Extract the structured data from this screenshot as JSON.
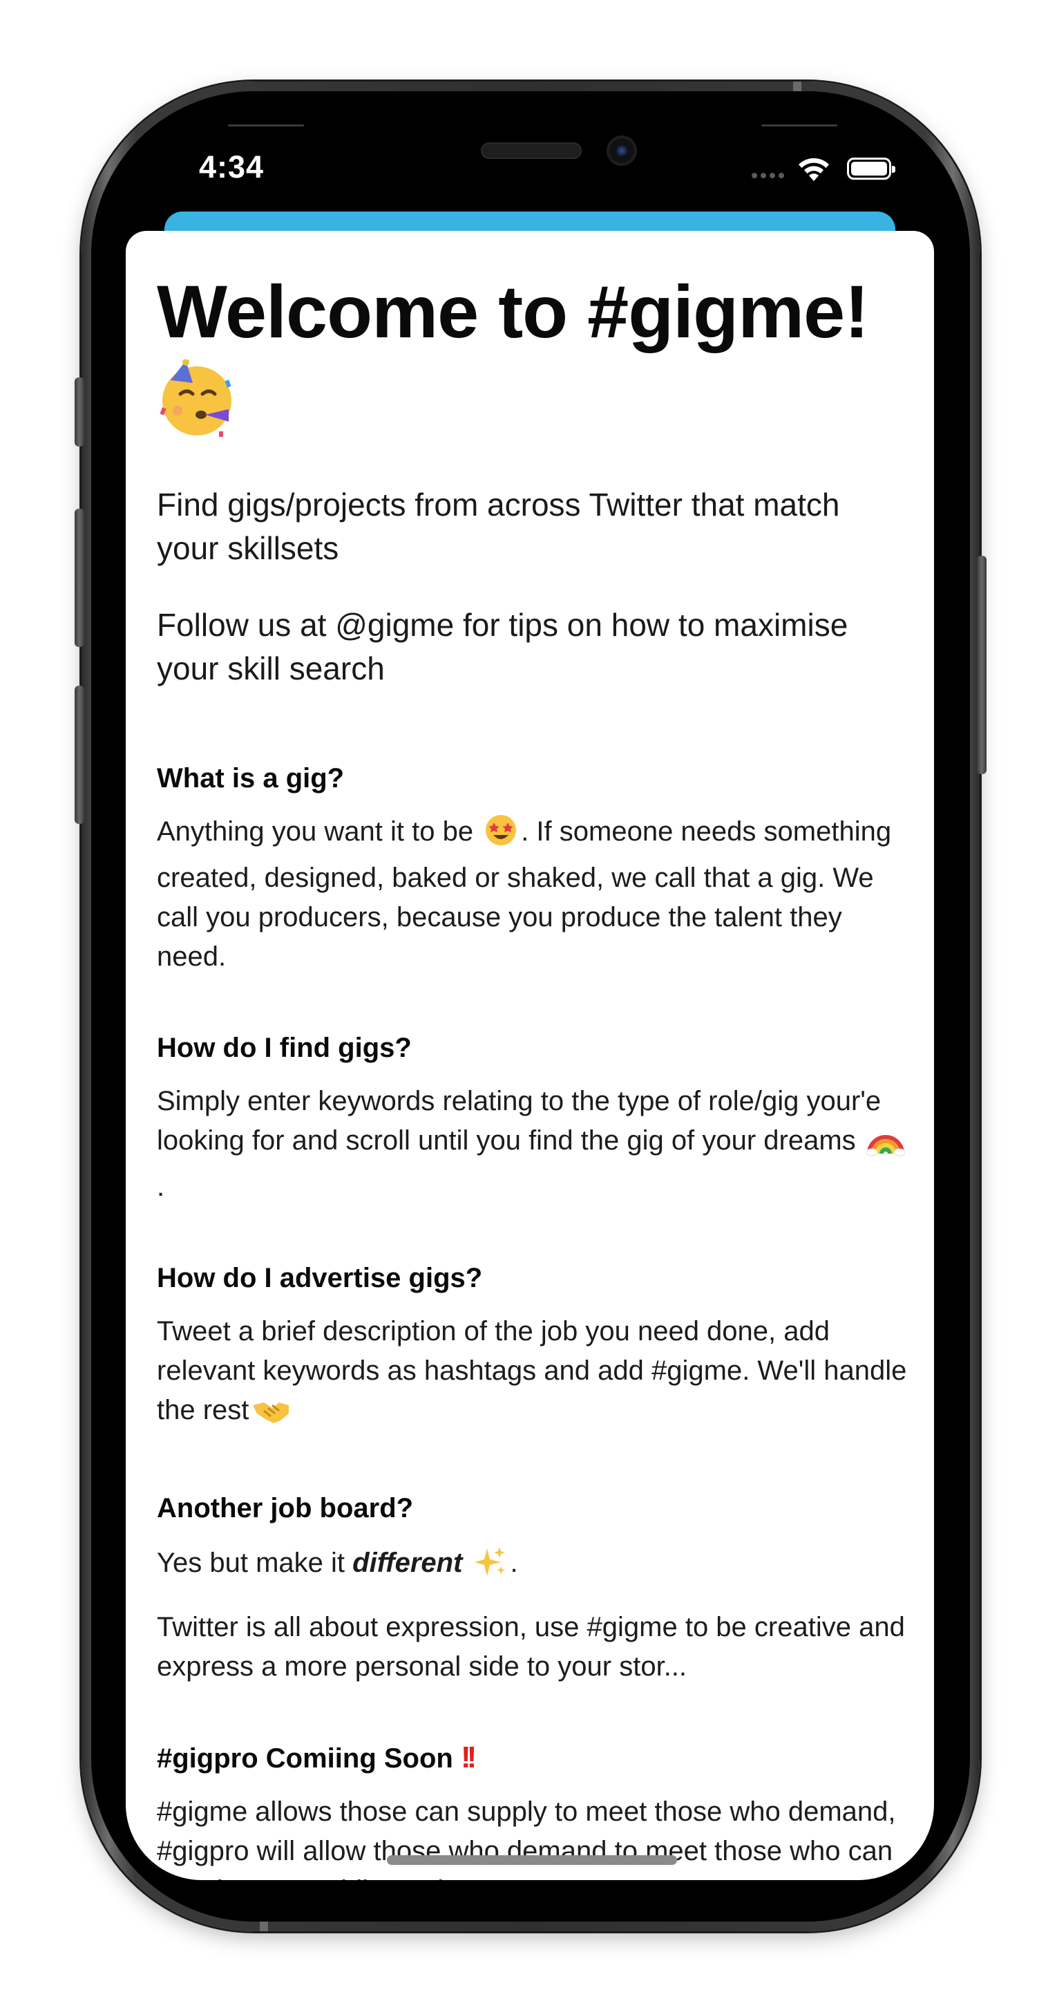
{
  "status_bar": {
    "time": "4:34"
  },
  "page": {
    "title": "Welcome to #gigme!",
    "intro": [
      "Find gigs/projects from across Twitter that match your skillsets",
      "Follow us at @gigme for tips on how to maximise your skill search"
    ]
  },
  "faq": {
    "gig": {
      "question": "What is a gig?",
      "answer_before_emoji": "Anything you want it to be",
      "answer_after_emoji": ". If someone needs something created, designed, baked or shaked, we call that a gig. We call you producers, because you produce the talent they need."
    },
    "find": {
      "question": "How do I find gigs?",
      "answer_before_emoji": "Simply enter keywords relating to the type of role/gig your'e looking for and scroll until you find the gig of your dreams",
      "answer_after_emoji": "."
    },
    "advertise": {
      "question": "How do I advertise gigs?",
      "answer": "Tweet a brief description of the job you need done, add relevant keywords as hashtags and add #gigme. We'll handle the rest"
    },
    "board": {
      "question": "Another job board?",
      "answer_lead": "Yes but make it",
      "answer_emphasis": "different",
      "answer_tail": ".",
      "answer_body": "Twitter is all about expression, use #gigme to be creative and express a more personal side to your stor..."
    },
    "gigpro": {
      "question": "#gigpro Comiing Soon",
      "answer": "#gigme allows those can supply to meet those who demand, #gigpro will allow those who demand to meet those who can supply. Start adding #gigpro to your"
    }
  },
  "icons": {
    "party-face": "partying-face-emoji",
    "star-struck": "star-struck-emoji",
    "rainbow": "rainbow-emoji",
    "handshake": "handshake-emoji",
    "sparkles": "sparkles-emoji",
    "double-exclamation": "double-exclamation-emoji"
  },
  "colors": {
    "sheet_header": "#38b3e2",
    "text": "#111111",
    "alert": "#e02020"
  }
}
